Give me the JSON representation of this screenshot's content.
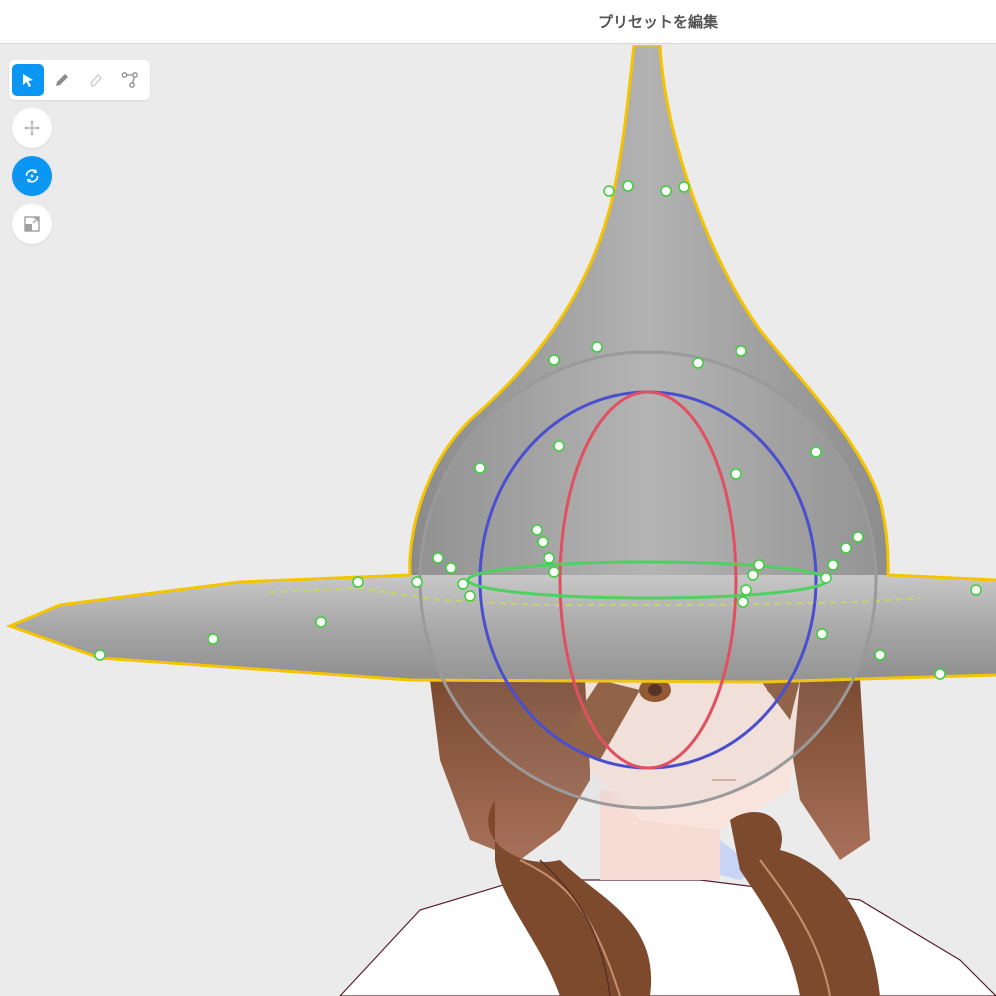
{
  "header": {
    "title": "プリセットを編集"
  },
  "toolbar": {
    "tools": [
      {
        "icon": "select-arrow-icon",
        "active": true
      },
      {
        "icon": "pencil-icon",
        "active": false
      },
      {
        "icon": "eraser-icon",
        "active": false
      },
      {
        "icon": "bone-chain-icon",
        "active": false
      }
    ]
  },
  "transform_modes": [
    {
      "icon": "move-icon",
      "active": false
    },
    {
      "icon": "rotate-icon",
      "active": true
    },
    {
      "icon": "scale-icon",
      "active": false
    }
  ],
  "colors": {
    "accent": "#0a96f2",
    "outline": "#f5c400",
    "gizmo_x": "#e05060",
    "gizmo_y": "#4a4fd0",
    "gizmo_z": "#4fd060",
    "bone_point": "#3ccf3c"
  }
}
